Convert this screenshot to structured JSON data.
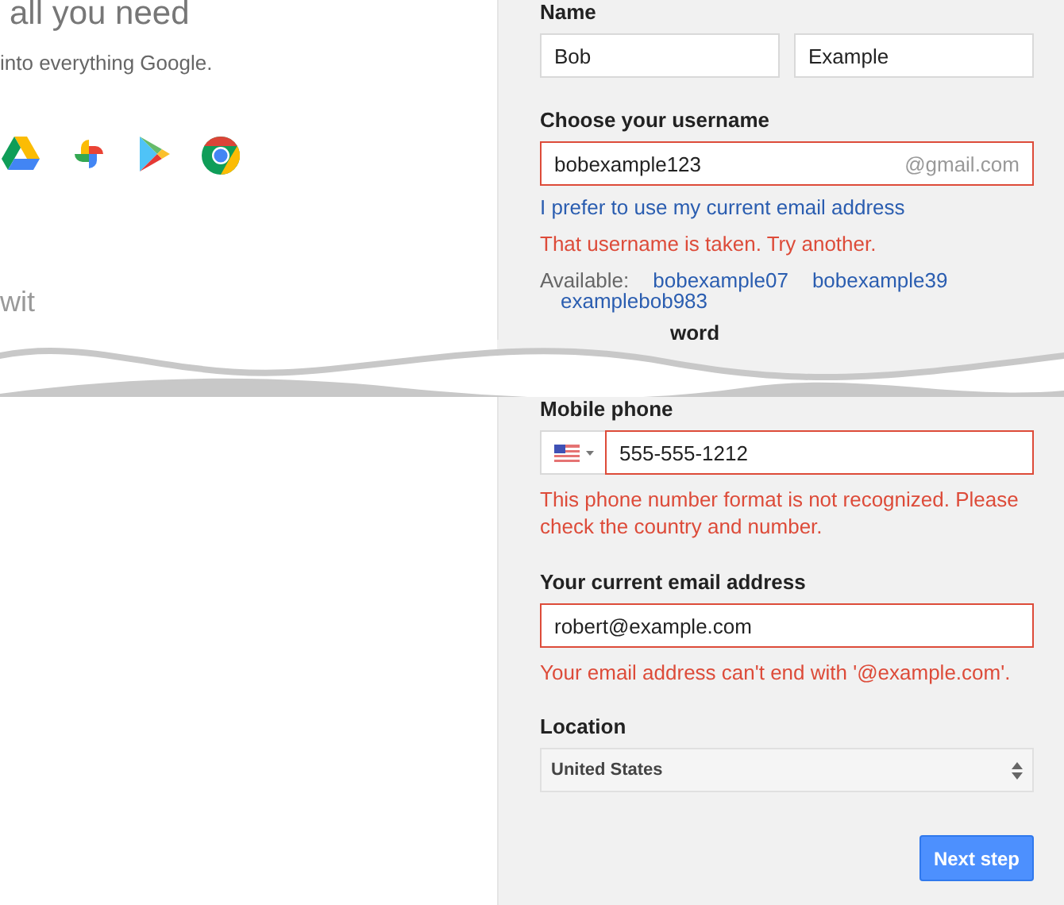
{
  "intro": {
    "heading": "all you need",
    "subheading": "into everything Google.",
    "fragment": "wit"
  },
  "form": {
    "name": {
      "label": "Name",
      "fields": [
        {
          "value": "Bob",
          "invalid": false
        },
        {
          "value": "Example",
          "invalid": false
        }
      ]
    },
    "username": {
      "label": "Choose your username",
      "value": "bobexample123",
      "suffix": "@gmail.com",
      "invalid": true,
      "link": "I prefer to use my current email address",
      "error": "That username is taken. Try another.",
      "available_label": "Available:",
      "suggestions": [
        "bobexample07",
        "bobexample39",
        "examplebob983"
      ]
    },
    "password_fragment": "word",
    "phone": {
      "label": "Mobile phone",
      "value": "555-555-1212",
      "invalid": true,
      "error": "This phone number format is not recognized. Please check the country and number."
    },
    "email": {
      "label": "Your current email address",
      "value": "robert@example.com",
      "invalid": true,
      "error": "Your email address can't end with '@example.com'."
    },
    "location": {
      "label": "Location",
      "value": "United States"
    },
    "next_button": "Next step"
  }
}
